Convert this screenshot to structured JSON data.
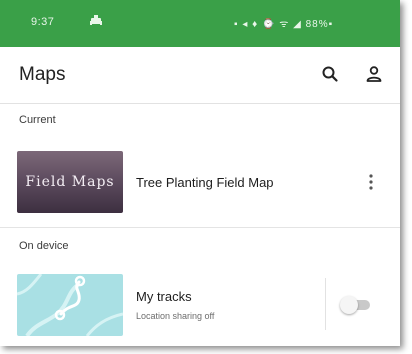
{
  "status_bar": {
    "time": "9:37",
    "icons_text": "▪ ◂ ♦ ⌚ ᯤ ◢ 88%▪",
    "background": "#3aa048"
  },
  "app_bar": {
    "title": "Maps",
    "search_icon": "search-icon",
    "account_icon": "account-icon"
  },
  "sections": {
    "current": {
      "label": "Current",
      "maps": [
        {
          "thumbnail_text": "Field Maps",
          "title": "Tree Planting Field Map",
          "menu_icon": "more-vert-icon"
        }
      ]
    },
    "on_device": {
      "label": "On device",
      "items": [
        {
          "title": "My tracks",
          "subtitle": "Location sharing off",
          "toggle_on": false
        }
      ]
    }
  }
}
